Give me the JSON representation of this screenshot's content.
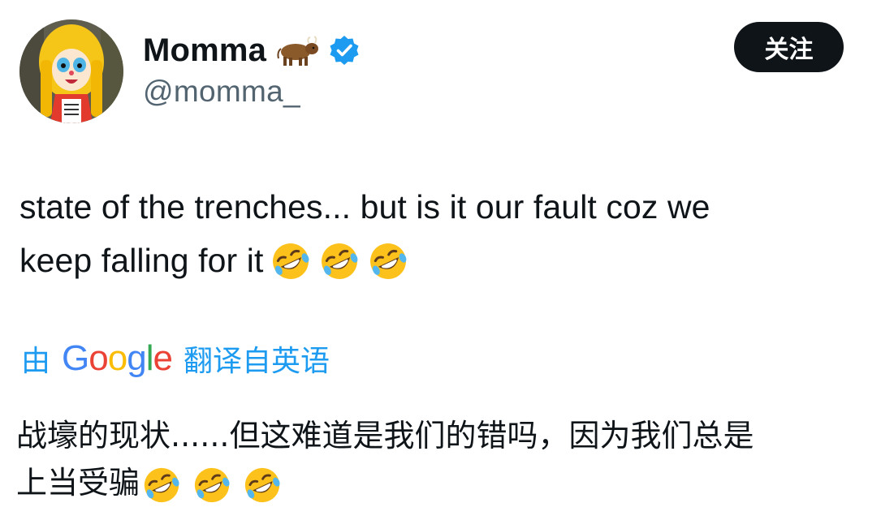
{
  "author": {
    "display_name": "Momma",
    "handle": "@momma_",
    "name_emoji": "ox-icon",
    "verified": true,
    "avatar": "avatar-cartoon-icon"
  },
  "follow_button": {
    "label": "关注"
  },
  "tweet": {
    "line1": "state of the trenches... but is it our fault coz we",
    "line2": "keep falling for it",
    "trailing_emoji": [
      "rolling-on-floor-laughing-icon",
      "rolling-on-floor-laughing-icon",
      "rolling-on-floor-laughing-icon"
    ]
  },
  "translation": {
    "by_label": "由",
    "service": "Google",
    "from_label": "翻译自英语",
    "line1": "战壕的现状......但这难道是我们的错吗，因为我们总是",
    "line2": "上当受骗",
    "trailing_emoji": [
      "rolling-on-floor-laughing-icon",
      "rolling-on-floor-laughing-icon",
      "rolling-on-floor-laughing-icon"
    ]
  },
  "colors": {
    "text": "#0f1419",
    "secondary_text": "#536471",
    "link_blue": "#1d9bf0",
    "verified_blue": "#1d9bf0",
    "follow_bg": "#0f1419",
    "google_blue": "#4285f4",
    "google_red": "#ea4335",
    "google_yellow": "#fbbc05",
    "google_green": "#34a853"
  }
}
